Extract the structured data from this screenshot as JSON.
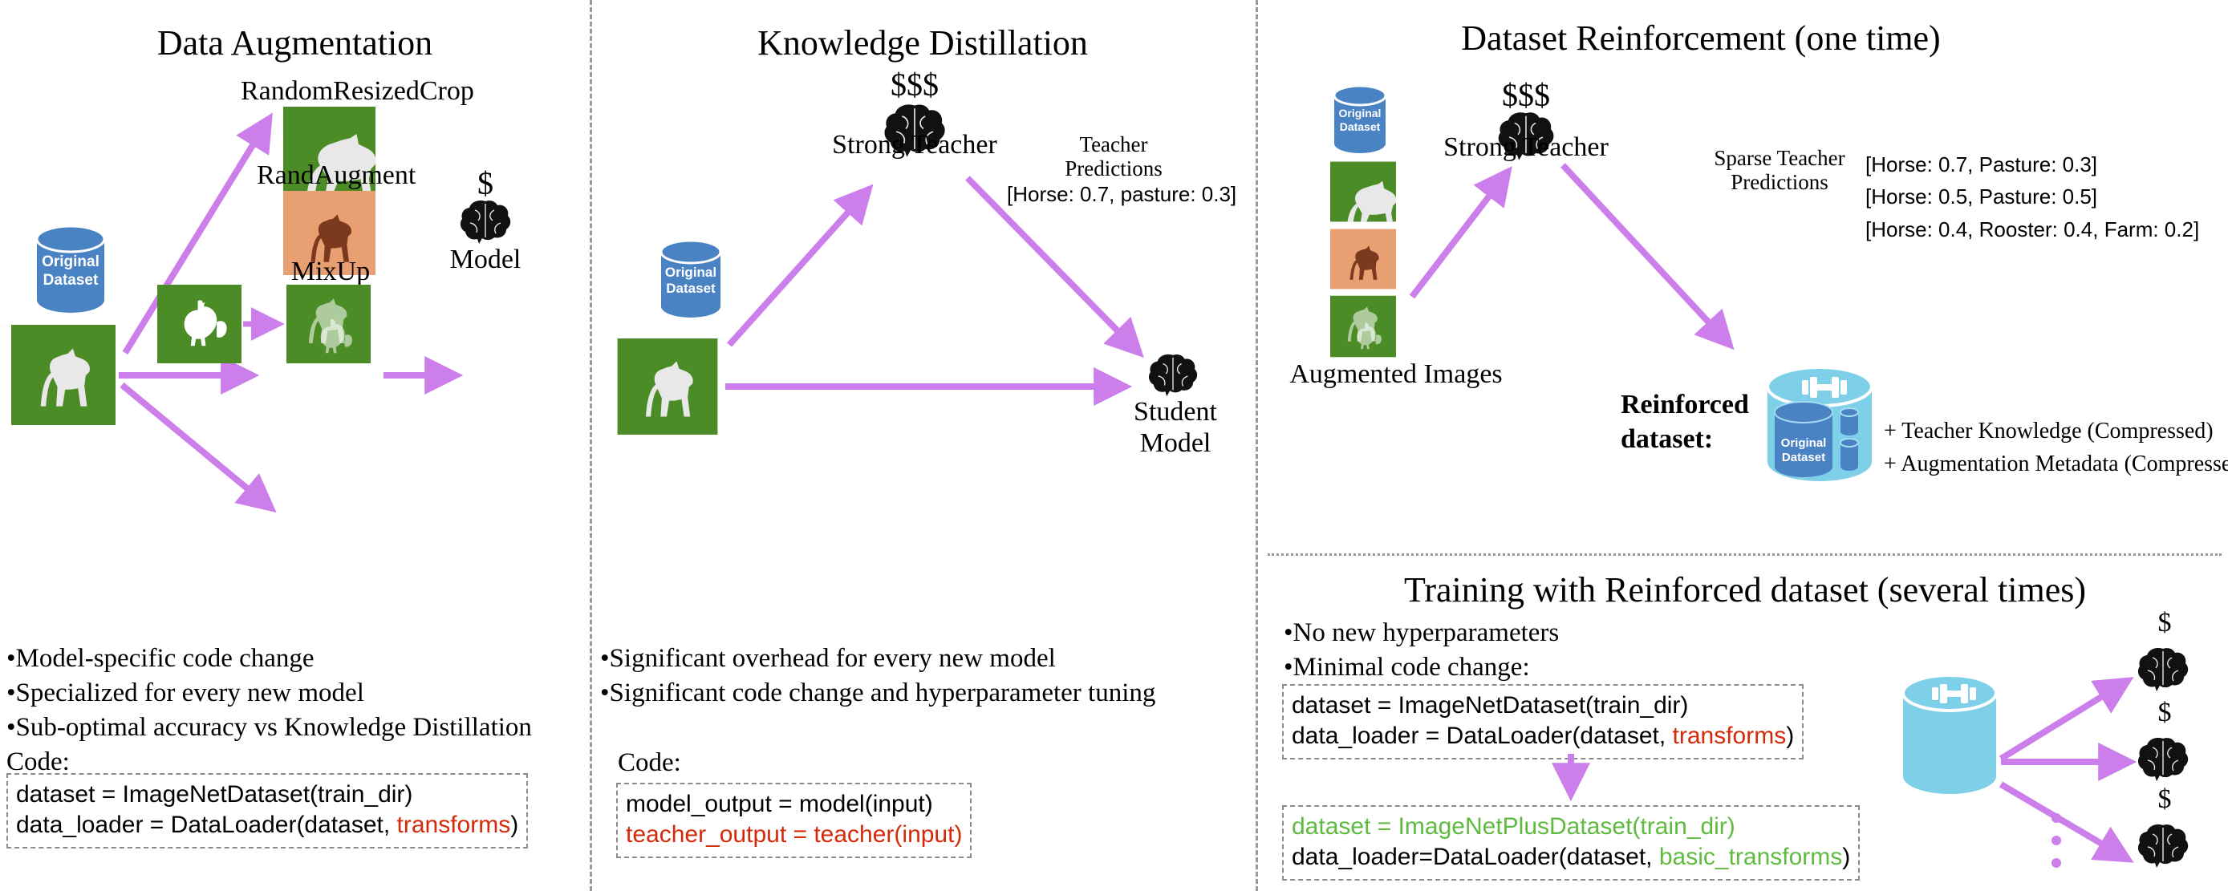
{
  "colors": {
    "arrow": "#cc7fea",
    "green_bg": "#4c8c26",
    "orange_bg": "#e8a072",
    "blue_cyl": "#4a83c4",
    "cyan_cyl": "#7ed0e8",
    "code_red": "#d42a0a",
    "code_green": "#5fbb3f",
    "divider": "#9a9a9a"
  },
  "panels": {
    "data_augmentation": {
      "title": "Data Augmentation",
      "dataset_cylinder_label_line1": "Original",
      "dataset_cylinder_label_line2": "Dataset",
      "aug_labels": {
        "random_resized_crop": "RandomResizedCrop",
        "rand_augment": "RandAugment",
        "mixup": "MixUp"
      },
      "model_money": "$",
      "model_label": "Model",
      "bullets": [
        "•Model-specific code change",
        "•Specialized for every new model",
        "•Sub-optimal accuracy vs Knowledge Distillation"
      ],
      "code_caption": "Code:",
      "code_line1": "dataset = ImageNetDataset(train_dir)",
      "code_line2_prefix": "data_loader = DataLoader(dataset, ",
      "code_line2_highlight": "transforms",
      "code_line2_suffix": ")"
    },
    "knowledge_distillation": {
      "title": "Knowledge Distillation",
      "teacher_money": "$$$",
      "teacher_label": "Strong Teacher",
      "dataset_cylinder_label_line1": "Original",
      "dataset_cylinder_label_line2": "Dataset",
      "teacher_predictions_line1": "Teacher",
      "teacher_predictions_line2": "Predictions",
      "prediction_value": "[Horse: 0.7, pasture: 0.3]",
      "student_label_line1": "Student",
      "student_label_line2": "Model",
      "bullets": [
        "•Significant overhead for every new model",
        "•Significant code change and hyperparameter tuning"
      ],
      "code_caption": "Code:",
      "code_line1": "model_output = model(input)",
      "code_line2": "teacher_output = teacher(input)"
    },
    "dataset_reinforcement": {
      "title": "Dataset Reinforcement (one time)",
      "dataset_cylinder_label_line1": "Original",
      "dataset_cylinder_label_line2": "Dataset",
      "augmented_images_label": "Augmented Images",
      "teacher_money": "$$$",
      "teacher_label": "Strong Teacher",
      "sparse_predictions_line1": "Sparse Teacher",
      "sparse_predictions_line2": "Predictions",
      "predictions": [
        "[Horse: 0.7, Pasture: 0.3]",
        "[Horse: 0.5, Pasture: 0.5]",
        "[Horse: 0.4, Rooster: 0.4, Farm: 0.2]"
      ],
      "reinforced_label_line1": "Reinforced",
      "reinforced_label_line2": "dataset:",
      "reinforced_cylinder_label_line1": "Original",
      "reinforced_cylinder_label_line2": "Dataset",
      "additions": [
        "+ Teacher Knowledge (Compressed)",
        "+ Augmentation Metadata (Compressed)"
      ]
    },
    "training_reinforced": {
      "title": "Training with Reinforced dataset (several times)",
      "bullets": [
        "•No new hyperparameters",
        "•Minimal code change:"
      ],
      "code_before_line1": "dataset = ImageNetDataset(train_dir)",
      "code_before_line2_prefix": "data_loader = DataLoader(dataset, ",
      "code_before_line2_highlight": "transforms",
      "code_before_line2_suffix": ")",
      "code_after_line1": "dataset = ImageNetPlusDataset(train_dir)",
      "code_after_line2_prefix": "data_loader=DataLoader(dataset, ",
      "code_after_line2_highlight": "basic_transforms",
      "code_after_line2_suffix": ")",
      "model_money": "$",
      "ellipsis": "⋮"
    }
  }
}
